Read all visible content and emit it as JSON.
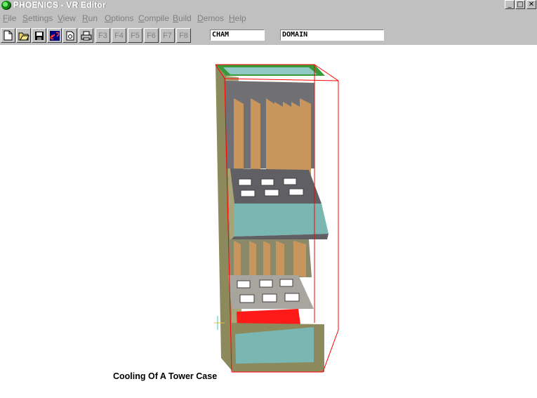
{
  "window": {
    "title": "PHOENICS - VR Editor",
    "min_symbol": "_",
    "max_symbol": "□",
    "close_symbol": "✕"
  },
  "menu": [
    {
      "label": "File",
      "u": "F",
      "rest": "ile"
    },
    {
      "label": "Settings",
      "u": "S",
      "rest": "ettings"
    },
    {
      "label": "View",
      "u": "V",
      "rest": "iew"
    },
    {
      "label": "Run",
      "u": "R",
      "rest": "un"
    },
    {
      "label": "Options",
      "u": "O",
      "rest": "ptions"
    },
    {
      "label": "Compile",
      "u": "C",
      "rest": "ompile"
    },
    {
      "label": "Build",
      "u": "B",
      "rest": "uild"
    },
    {
      "label": "Demos",
      "u": "D",
      "rest": "emos"
    },
    {
      "label": "Help",
      "u": "H",
      "rest": "elp"
    }
  ],
  "toolbar": {
    "fkeys": [
      "F3",
      "F4",
      "F5",
      "F6",
      "F7",
      "F8"
    ],
    "field1": "CHAM",
    "field2": "DOMAIN"
  },
  "scene": {
    "caption": "Cooling Of A Tower Case"
  },
  "colors": {
    "chrome": "#c0c0c0",
    "fin": "#c8955c",
    "plate": "#6e6e72",
    "water": "#78b4b0",
    "heater": "#ff1a1a",
    "case": "#8c8a5c",
    "outline": "#ff0000"
  }
}
